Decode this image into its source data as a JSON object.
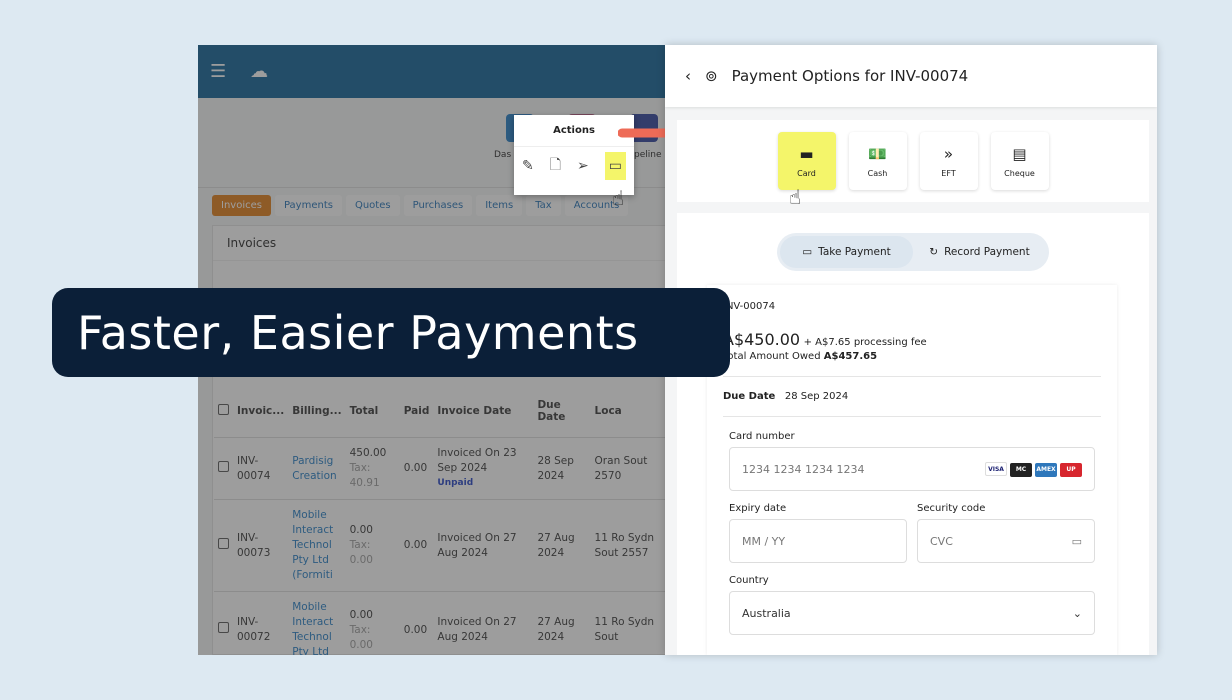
{
  "headline": "Faster, Easier Payments",
  "app": {
    "tabs": [
      "Invoices",
      "Payments",
      "Quotes",
      "Purchases",
      "Items",
      "Tax",
      "Accounts"
    ],
    "panel_title": "Invoices",
    "quick_labels": [
      "Das",
      "peline"
    ],
    "columns": [
      "Invoic...",
      "Billing...",
      "Total",
      "Paid",
      "Invoice Date",
      "Due Date",
      "Loca"
    ],
    "rows": [
      {
        "id": "INV-00074",
        "billing": "Pardisig Creation",
        "total": "450.00",
        "tax": "Tax: 40.91",
        "paid": "0.00",
        "invoice_date": "Invoiced On 23 Sep 2024",
        "status": "Unpaid",
        "due": "28 Sep 2024",
        "loc": "Oran Sout 2570"
      },
      {
        "id": "INV-00073",
        "billing": "Mobile Interact Technol Pty Ltd (Formiti",
        "total": "0.00",
        "tax": "Tax: 0.00",
        "paid": "0.00",
        "invoice_date": "Invoiced On 27 Aug 2024",
        "status": "",
        "due": "27 Aug 2024",
        "loc": "11 Ro Sydn Sout 2557"
      },
      {
        "id": "INV-00072",
        "billing": "Mobile Interact Technol Pty Ltd",
        "total": "0.00",
        "tax": "Tax: 0.00",
        "paid": "0.00",
        "invoice_date": "Invoiced On 27 Aug 2024",
        "status": "",
        "due": "27 Aug 2024",
        "loc": "11 Ro Sydn Sout"
      }
    ]
  },
  "actions": {
    "title": "Actions",
    "icons": [
      "pencil-icon",
      "document-icon",
      "send-icon",
      "card-icon"
    ]
  },
  "payment": {
    "title": "Payment Options for INV-00074",
    "methods": [
      "Card",
      "Cash",
      "EFT",
      "Cheque"
    ],
    "selected_method": "Card",
    "modes": [
      "Take Payment",
      "Record Payment"
    ],
    "invoice": "INV-00074",
    "amount": "A$450.00",
    "fee": "+ A$7.65 processing fee",
    "owed_label": "Total Amount Owed",
    "owed": "A$457.65",
    "due_label": "Due Date",
    "due": "28 Sep 2024",
    "card_label": "Card number",
    "card_ph": "1234 1234 1234 1234",
    "brands": [
      "VISA",
      "MC",
      "AMEX",
      "UP"
    ],
    "expiry_label": "Expiry date",
    "expiry_ph": "MM / YY",
    "cvc_label": "Security code",
    "cvc_ph": "CVC",
    "country_label": "Country",
    "country": "Australia"
  },
  "colors": {
    "header": "#0a5f95",
    "highlight": "#f4f56a",
    "arrow": "#ee6b57",
    "banner": "#0b1f38"
  }
}
